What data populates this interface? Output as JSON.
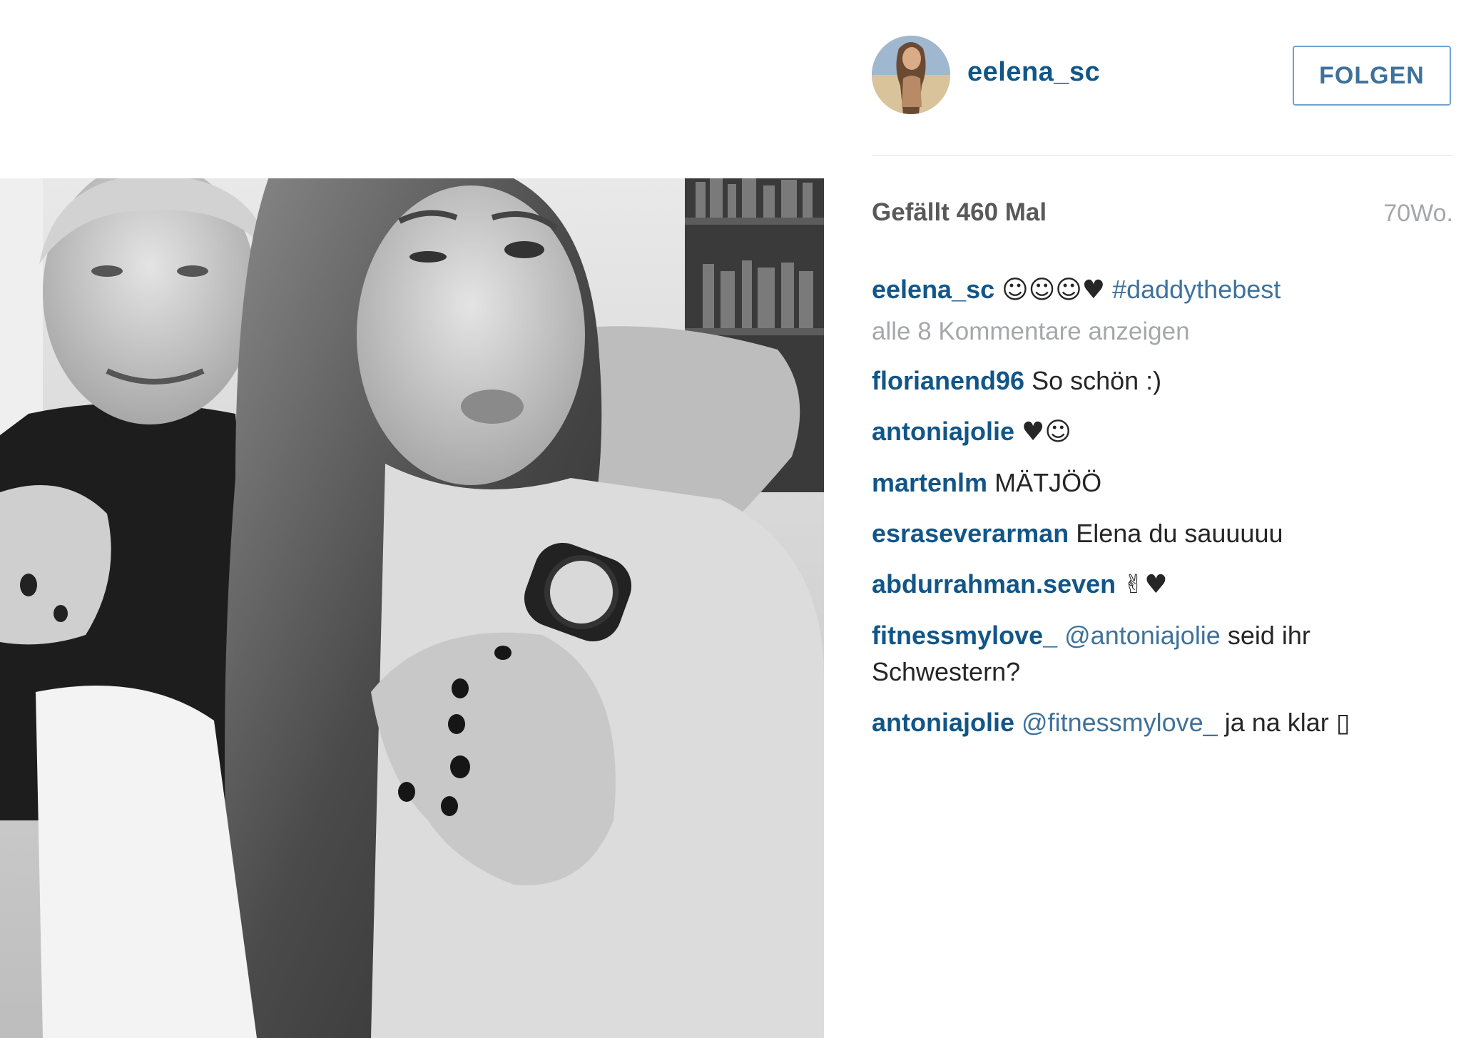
{
  "header": {
    "username": "eelena_sc",
    "follow_label": "FOLGEN"
  },
  "post": {
    "likes_text": "Gefällt 460 Mal",
    "age_text": "70Wo.",
    "view_all_comments": "alle 8 Kommentare anzeigen",
    "caption": {
      "user": "eelena_sc",
      "emoji": "☺☺☺♥",
      "hashtag": "#daddythebest"
    },
    "comments": [
      {
        "user": "florianend96",
        "text": "So schön :)"
      },
      {
        "user": "antoniajolie",
        "text": "♥☺"
      },
      {
        "user": "martenlm",
        "text": "MÄTJÖÖ"
      },
      {
        "user": "esraseverarman",
        "text": "Elena du sauuuuu"
      },
      {
        "user": "abdurrahman.seven",
        "text": "✌♥"
      },
      {
        "user": "fitnessmylove_",
        "mention": "@antoniajolie",
        "text": "seid ihr Schwestern?"
      },
      {
        "user": "antoniajolie",
        "mention": "@fitnessmylove_",
        "text": "ja na klar ▯"
      }
    ]
  },
  "colors": {
    "username": "#125688",
    "link": "#3f729b",
    "muted": "#a5a7aa",
    "text": "#262626"
  }
}
